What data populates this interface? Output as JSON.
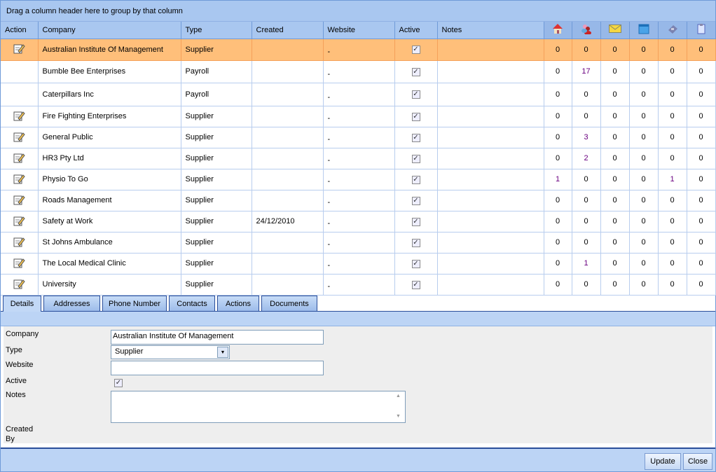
{
  "grid": {
    "group_hint": "Drag a column header here to group by that column",
    "columns": [
      "Action",
      "Company",
      "Type",
      "Created",
      "Website",
      "Active",
      "Notes"
    ],
    "icon_columns": [
      "home-icon",
      "contacts-icon",
      "email-icon",
      "calendar-icon",
      "phone-icon",
      "clipboard-icon"
    ],
    "rows": [
      {
        "edit": true,
        "company": "Australian Institute Of Management",
        "type": "Supplier",
        "created": "",
        "website": "-",
        "active": true,
        "notes": "",
        "counts": [
          "0",
          "0",
          "0",
          "0",
          "0",
          "0"
        ],
        "selected": true
      },
      {
        "edit": false,
        "company": "Bumble Bee Enterprises",
        "type": "Payroll",
        "created": "",
        "website": "-",
        "active": true,
        "notes": "",
        "counts": [
          "0",
          "17",
          "0",
          "0",
          "0",
          "0"
        ]
      },
      {
        "edit": false,
        "company": "Caterpillars Inc",
        "type": "Payroll",
        "created": "",
        "website": "-",
        "active": true,
        "notes": "",
        "counts": [
          "0",
          "0",
          "0",
          "0",
          "0",
          "0"
        ]
      },
      {
        "edit": true,
        "company": "Fire Fighting Enterprises",
        "type": "Supplier",
        "created": "",
        "website": "-",
        "active": true,
        "notes": "",
        "counts": [
          "0",
          "0",
          "0",
          "0",
          "0",
          "0"
        ]
      },
      {
        "edit": true,
        "company": "General Public",
        "type": "Supplier",
        "created": "",
        "website": "-",
        "active": true,
        "notes": "",
        "counts": [
          "0",
          "3",
          "0",
          "0",
          "0",
          "0"
        ]
      },
      {
        "edit": true,
        "company": "HR3 Pty Ltd",
        "type": "Supplier",
        "created": "",
        "website": "-",
        "active": true,
        "notes": "",
        "counts": [
          "0",
          "2",
          "0",
          "0",
          "0",
          "0"
        ]
      },
      {
        "edit": true,
        "company": "Physio To Go",
        "type": "Supplier",
        "created": "",
        "website": "-",
        "active": true,
        "notes": "",
        "counts": [
          "1",
          "0",
          "0",
          "0",
          "1",
          "0"
        ]
      },
      {
        "edit": true,
        "company": "Roads Management",
        "type": "Supplier",
        "created": "",
        "website": "-",
        "active": true,
        "notes": "",
        "counts": [
          "0",
          "0",
          "0",
          "0",
          "0",
          "0"
        ]
      },
      {
        "edit": true,
        "company": "Safety at Work",
        "type": "Supplier",
        "created": "24/12/2010",
        "website": "-",
        "active": true,
        "notes": "",
        "counts": [
          "0",
          "0",
          "0",
          "0",
          "0",
          "0"
        ]
      },
      {
        "edit": true,
        "company": "St Johns Ambulance",
        "type": "Supplier",
        "created": "",
        "website": "-",
        "active": true,
        "notes": "",
        "counts": [
          "0",
          "0",
          "0",
          "0",
          "0",
          "0"
        ]
      },
      {
        "edit": true,
        "company": "The Local Medical Clinic",
        "type": "Supplier",
        "created": "",
        "website": "-",
        "active": true,
        "notes": "",
        "counts": [
          "0",
          "1",
          "0",
          "0",
          "0",
          "0"
        ]
      },
      {
        "edit": true,
        "company": "University",
        "type": "Supplier",
        "created": "",
        "website": "-",
        "active": true,
        "notes": "",
        "counts": [
          "0",
          "0",
          "0",
          "0",
          "0",
          "0"
        ]
      }
    ]
  },
  "tabs": [
    "Details",
    "Addresses",
    "Phone Number",
    "Contacts",
    "Actions",
    "Documents"
  ],
  "details": {
    "company_label": "Company",
    "company_value": "Australian Institute Of Management",
    "type_label": "Type",
    "type_value": "Supplier",
    "website_label": "Website",
    "website_value": "",
    "active_label": "Active",
    "active": true,
    "notes_label": "Notes",
    "notes_value": "",
    "created_by_label": "Created By"
  },
  "footer": {
    "update": "Update",
    "close": "Close"
  },
  "colors": {
    "header": "#a9c7f0",
    "selected_row": "#ffbf7a",
    "highlight_count": "#6a0080"
  }
}
